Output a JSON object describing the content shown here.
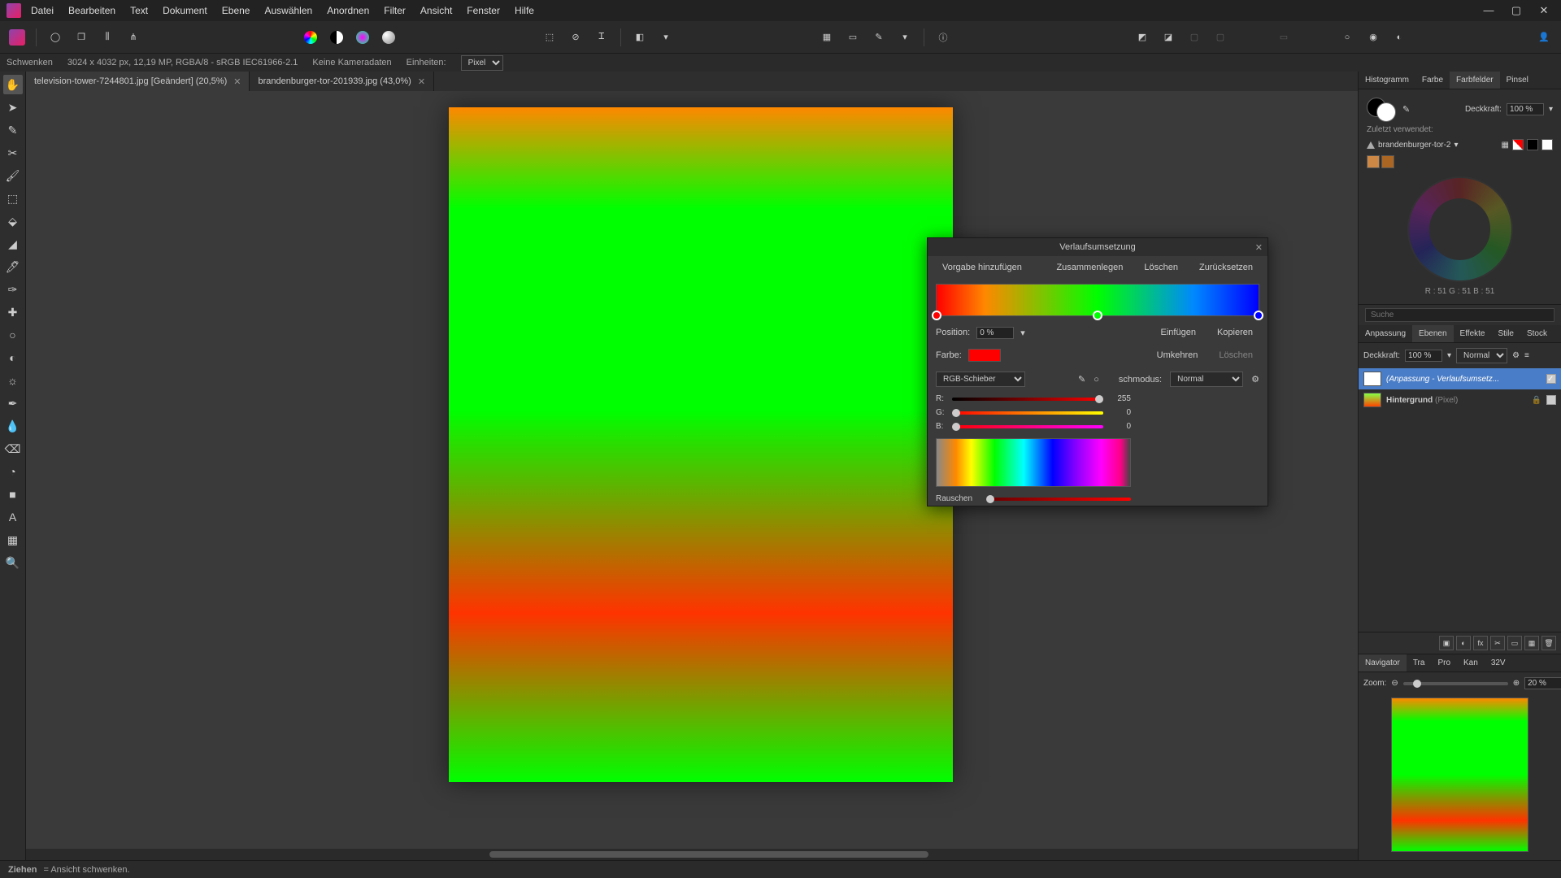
{
  "menu": [
    "Datei",
    "Bearbeiten",
    "Text",
    "Dokument",
    "Ebene",
    "Auswählen",
    "Anordnen",
    "Filter",
    "Ansicht",
    "Fenster",
    "Hilfe"
  ],
  "docinfo": {
    "mode": "Schwenken",
    "dims": "3024 x 4032 px, 12,19 MP, RGBA/8 - sRGB IEC61966-2.1",
    "camera": "Keine Kameradaten",
    "units_label": "Einheiten:",
    "units": "Pixel"
  },
  "tabs": [
    {
      "label": "television-tower-7244801.jpg [Geändert] (20,5%)",
      "active": true
    },
    {
      "label": "brandenburger-tor-201939.jpg (43,0%)",
      "active": false
    }
  ],
  "dialog": {
    "title": "Verlaufsumsetzung",
    "add_preset": "Vorgabe hinzufügen",
    "merge": "Zusammenlegen",
    "delete": "Löschen",
    "reset": "Zurücksetzen",
    "position_label": "Position:",
    "position_val": "0 %",
    "color_label": "Farbe:",
    "insert": "Einfügen",
    "copy": "Kopieren",
    "reverse": "Umkehren",
    "del2": "Löschen",
    "mode_label": "RGB-Schieber",
    "blend_label": "schmodus:",
    "blend_val": "Normal",
    "r": "R:",
    "r_val": "255",
    "g": "G:",
    "g_val": "0",
    "b": "B:",
    "b_val": "0",
    "noise": "Rauschen",
    "stops": [
      {
        "pos": 0,
        "color": "#ff0000"
      },
      {
        "pos": 50,
        "color": "#00ff00"
      },
      {
        "pos": 100,
        "color": "#0000ff"
      }
    ]
  },
  "right": {
    "tabs1": [
      "Histogramm",
      "Farbe",
      "Farbfelder",
      "Pinsel"
    ],
    "active_tab1": "Farbfelder",
    "opacity_label": "Deckkraft:",
    "opacity": "100 %",
    "recent_label": "Zuletzt verwendet:",
    "recent_name": "brandenburger-tor-2",
    "rgb_read": "R : 51 G : 51 B : 51",
    "search_ph": "Suche",
    "tabs2": [
      "Anpassung",
      "Ebenen",
      "Effekte",
      "Stile",
      "Stock"
    ],
    "active_tab2": "Ebenen",
    "deck_label": "Deckkraft:",
    "deck_val": "100 %",
    "blend": "Normal",
    "layers": [
      {
        "name": "(Anpassung - Verlaufsumsetz...",
        "sel": true
      },
      {
        "name": "Hintergrund",
        "type": "(Pixel)",
        "sel": false
      }
    ],
    "tabs3": [
      "Navigator",
      "Tra",
      "Pro",
      "Kan",
      "32V"
    ],
    "zoom_label": "Zoom:",
    "zoom_val": "20 %"
  },
  "status": {
    "action": "Ziehen",
    "desc": "= Ansicht schwenken."
  }
}
